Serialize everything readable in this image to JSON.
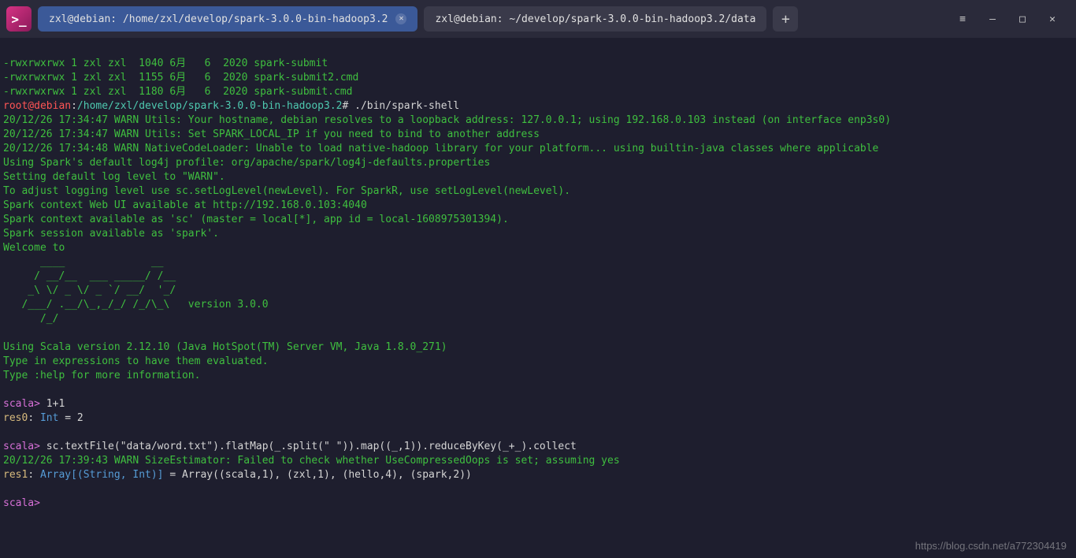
{
  "titlebar": {
    "tab_active": "zxl@debian: /home/zxl/develop/spark-3.0.0-bin-hadoop3.2",
    "tab_inactive": "zxl@debian: ~/develop/spark-3.0.0-bin-hadoop3.2/data",
    "new_tab": "+",
    "menu": "≡",
    "minimize": "—",
    "maximize": "□",
    "close": "✕"
  },
  "ls_lines": [
    "-rwxrwxrwx 1 zxl zxl  1040 6月   6  2020 spark-submit",
    "-rwxrwxrwx 1 zxl zxl  1155 6月   6  2020 spark-submit2.cmd",
    "-rwxrwxrwx 1 zxl zxl  1180 6月   6  2020 spark-submit.cmd"
  ],
  "prompt": {
    "user_host": "root@debian",
    "colon": ":",
    "path": "/home/zxl/develop/spark-3.0.0-bin-hadoop3.2",
    "hash": "#",
    "cmd": " ./bin/spark-shell"
  },
  "warn_lines": [
    "20/12/26 17:34:47 WARN Utils: Your hostname, debian resolves to a loopback address: 127.0.0.1; using 192.168.0.103 instead (on interface enp3s0)",
    "20/12/26 17:34:47 WARN Utils: Set SPARK_LOCAL_IP if you need to bind to another address",
    "20/12/26 17:34:48 WARN NativeCodeLoader: Unable to load native-hadoop library for your platform... using builtin-java classes where applicable",
    "Using Spark's default log4j profile: org/apache/spark/log4j-defaults.properties",
    "Setting default log level to \"WARN\".",
    "To adjust logging level use sc.setLogLevel(newLevel). For SparkR, use setLogLevel(newLevel).",
    "Spark context Web UI available at http://192.168.0.103:4040",
    "Spark context available as 'sc' (master = local[*], app id = local-1608975301394).",
    "Spark session available as 'spark'.",
    "Welcome to"
  ],
  "ascii_art": [
    "      ____              __",
    "     / __/__  ___ _____/ /__",
    "    _\\ \\/ _ \\/ _ `/ __/  '_/",
    "   /___/ .__/\\_,_/_/ /_/\\_\\   version 3.0.0",
    "      /_/"
  ],
  "scala_info": [
    "",
    "Using Scala version 2.12.10 (Java HotSpot(TM) Server VM, Java 1.8.0_271)",
    "Type in expressions to have them evaluated.",
    "Type :help for more information."
  ],
  "repl": {
    "prompt": "scala>",
    "cmd1": " 1+1",
    "res0_label": "res0",
    "res0_sep": ": ",
    "res0_type": "Int",
    "res0_rest": " = 2",
    "cmd2": " sc.textFile(\"data/word.txt\").flatMap(_.split(\" \")).map((_,1)).reduceByKey(_+_).collect",
    "warn": "20/12/26 17:39:43 WARN SizeEstimator: Failed to check whether UseCompressedOops is set; assuming yes",
    "res1_label": "res1",
    "res1_sep": ": ",
    "res1_type": "Array[(String, Int)]",
    "res1_rest": " = Array((scala,1), (zxl,1), (hello,4), (spark,2))"
  },
  "watermark": "https://blog.csdn.net/a772304419"
}
